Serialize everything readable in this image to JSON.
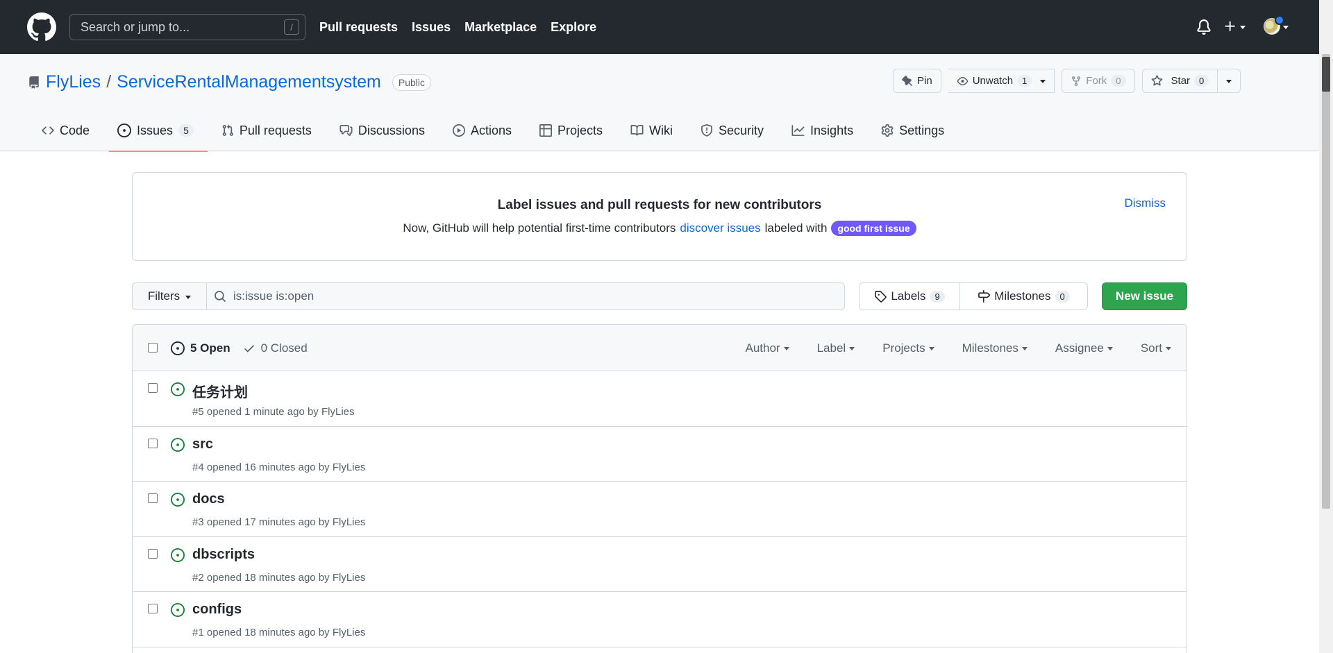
{
  "header": {
    "search_placeholder": "Search or jump to...",
    "slash_key": "/",
    "nav": [
      "Pull requests",
      "Issues",
      "Marketplace",
      "Explore"
    ]
  },
  "repo": {
    "owner": "FlyLies",
    "separator": "/",
    "name": "ServiceRentalManagementsystem",
    "visibility": "Public",
    "actions": {
      "pin": "Pin",
      "unwatch": "Unwatch",
      "unwatch_count": "1",
      "fork": "Fork",
      "fork_count": "0",
      "star": "Star",
      "star_count": "0"
    },
    "tabs": [
      {
        "label": "Code",
        "icon": "code-icon"
      },
      {
        "label": "Issues",
        "icon": "issue-opened-icon",
        "count": "5"
      },
      {
        "label": "Pull requests",
        "icon": "git-pull-request-icon"
      },
      {
        "label": "Discussions",
        "icon": "comment-discussion-icon"
      },
      {
        "label": "Actions",
        "icon": "play-icon"
      },
      {
        "label": "Projects",
        "icon": "table-icon"
      },
      {
        "label": "Wiki",
        "icon": "book-icon"
      },
      {
        "label": "Security",
        "icon": "shield-icon"
      },
      {
        "label": "Insights",
        "icon": "graph-icon"
      },
      {
        "label": "Settings",
        "icon": "gear-icon"
      }
    ]
  },
  "banner": {
    "title": "Label issues and pull requests for new contributors",
    "body_prefix": "Now, GitHub will help potential first-time contributors",
    "body_link": "discover issues",
    "body_mid": "labeled with",
    "label": "good first issue",
    "dismiss": "Dismiss"
  },
  "toolbar": {
    "filters": "Filters",
    "query": "is:issue is:open",
    "labels": "Labels",
    "labels_count": "9",
    "milestones": "Milestones",
    "milestones_count": "0",
    "new_issue": "New issue"
  },
  "list": {
    "open": "5 Open",
    "closed": "0 Closed",
    "menus": [
      "Author",
      "Label",
      "Projects",
      "Milestones",
      "Assignee",
      "Sort"
    ],
    "issues": [
      {
        "title": "任务计划",
        "meta": "#5 opened 1 minute ago by FlyLies"
      },
      {
        "title": "src",
        "meta": "#4 opened 16 minutes ago by FlyLies"
      },
      {
        "title": "docs",
        "meta": "#3 opened 17 minutes ago by FlyLies"
      },
      {
        "title": "dbscripts",
        "meta": "#2 opened 18 minutes ago by FlyLies"
      },
      {
        "title": "configs",
        "meta": "#1 opened 18 minutes ago by FlyLies"
      }
    ]
  },
  "colors": {
    "header_bg": "#24292f",
    "link": "#0969da",
    "open_green": "#1a7f37",
    "primary_button": "#2da44e",
    "active_tab_underline": "#fd8c73",
    "good_first_issue": "#7057ff"
  }
}
